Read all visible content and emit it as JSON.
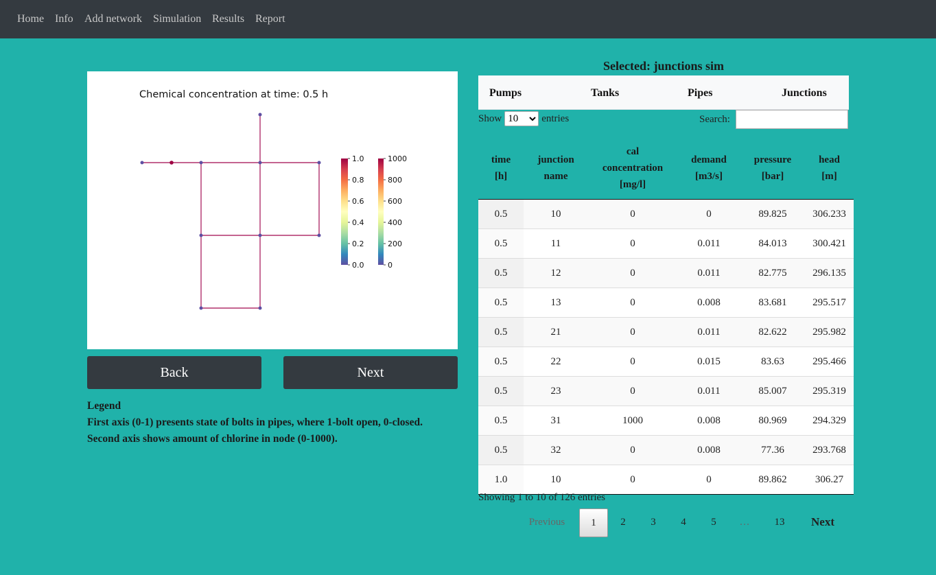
{
  "nav": {
    "items": [
      "Home",
      "Info",
      "Add network",
      "Simulation",
      "Results",
      "Report"
    ]
  },
  "plot": {
    "title": "Chemical concentration at time: 0.5 h",
    "colorbar1_ticks": [
      "1.0",
      "0.8",
      "0.6",
      "0.4",
      "0.2",
      "0.0"
    ],
    "colorbar2_ticks": [
      "1000",
      "800",
      "600",
      "400",
      "200",
      "0"
    ],
    "colors": {
      "pipe": "#b0306b",
      "node": "#5e4fa2",
      "highlight_node": "#9e0142"
    }
  },
  "buttons": {
    "back": "Back",
    "next": "Next"
  },
  "legend": {
    "title": "Legend",
    "line1": "First axis (0-1) presents state of bolts in pipes, where 1-bolt open, 0-closed.",
    "line2": "Second axis shows amount of chlorine in node (0-1000)."
  },
  "selected": "Selected: junctions sim",
  "tabs": [
    "Pumps",
    "Tanks",
    "Pipes",
    "Junctions"
  ],
  "controls": {
    "show_label": "Show",
    "page_size": "10",
    "entries_label": "entries",
    "search_label": "Search:"
  },
  "table": {
    "headers": [
      [
        "time",
        "[h]"
      ],
      [
        "junction",
        "name"
      ],
      [
        "cal",
        "concentration",
        "[mg/l]"
      ],
      [
        "demand",
        "[m3/s]"
      ],
      [
        "pressure",
        "[bar]"
      ],
      [
        "head",
        "[m]"
      ]
    ],
    "rows": [
      [
        "0.5",
        "10",
        "0",
        "0",
        "89.825",
        "306.233"
      ],
      [
        "0.5",
        "11",
        "0",
        "0.011",
        "84.013",
        "300.421"
      ],
      [
        "0.5",
        "12",
        "0",
        "0.011",
        "82.775",
        "296.135"
      ],
      [
        "0.5",
        "13",
        "0",
        "0.008",
        "83.681",
        "295.517"
      ],
      [
        "0.5",
        "21",
        "0",
        "0.011",
        "82.622",
        "295.982"
      ],
      [
        "0.5",
        "22",
        "0",
        "0.015",
        "83.63",
        "295.466"
      ],
      [
        "0.5",
        "23",
        "0",
        "0.011",
        "85.007",
        "295.319"
      ],
      [
        "0.5",
        "31",
        "1000",
        "0.008",
        "80.969",
        "294.329"
      ],
      [
        "0.5",
        "32",
        "0",
        "0.008",
        "77.36",
        "293.768"
      ],
      [
        "1.0",
        "10",
        "0",
        "0",
        "89.862",
        "306.27"
      ]
    ]
  },
  "info": "Showing 1 to 10 of 126 entries",
  "pagination": {
    "previous": "Previous",
    "pages": [
      "1",
      "2",
      "3",
      "4",
      "5",
      "…",
      "13"
    ],
    "next": "Next"
  }
}
